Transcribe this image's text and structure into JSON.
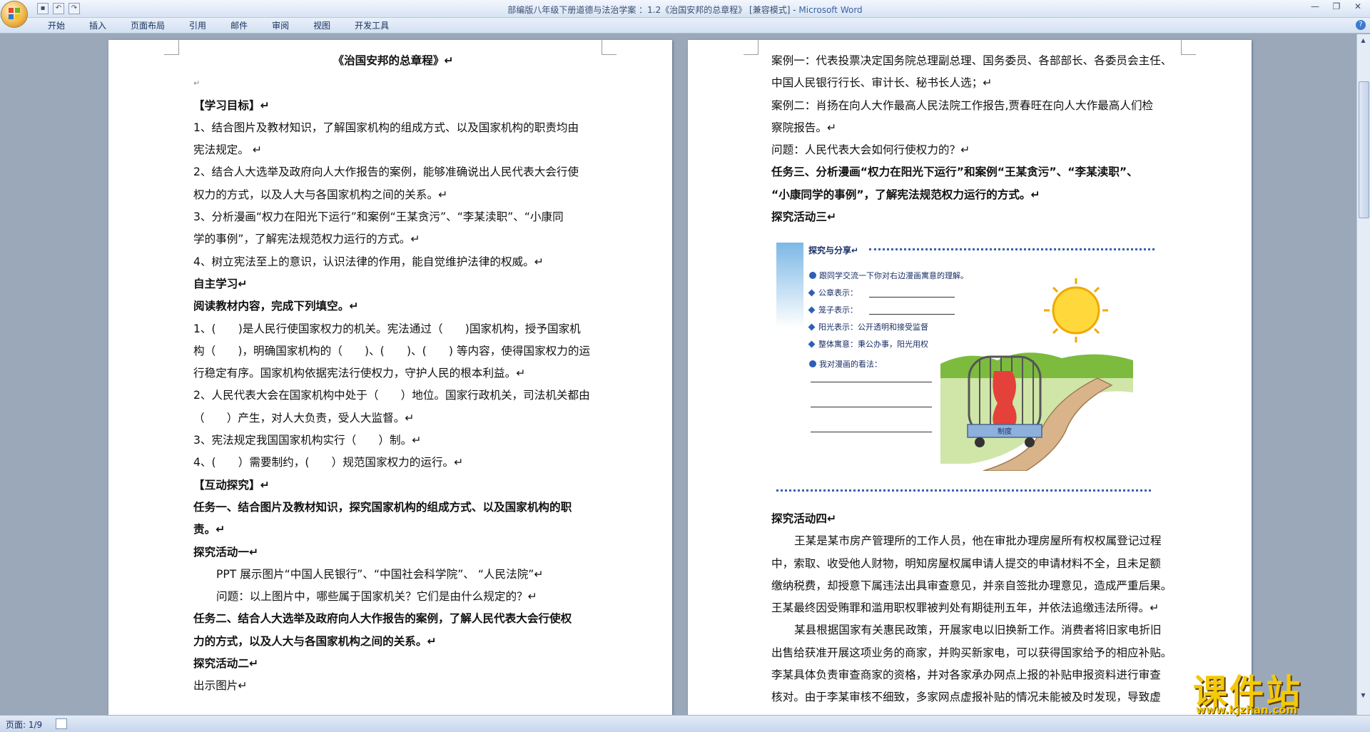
{
  "window": {
    "title": "部编版八年级下册道德与法治学案 ：1.2《治国安邦的总章程》 [兼容模式]",
    "app_name": "Microsoft Word"
  },
  "ribbon_tabs": [
    "开始",
    "插入",
    "页面布局",
    "引用",
    "邮件",
    "审阅",
    "视图",
    "开发工具"
  ],
  "status": {
    "page_info": "页面: 1/9"
  },
  "left_page": [
    {
      "t": "《治国安邦的总章程》↵",
      "s": "b ctr"
    },
    {
      "t": "↵",
      "s": "pm"
    },
    {
      "t": "【学习目标】↵",
      "s": "b"
    },
    {
      "t": "1、结合图片及教材知识，了解国家机构的组成方式、以及国家机构的职责均由",
      "s": ""
    },
    {
      "t": "宪法规定。 ↵",
      "s": ""
    },
    {
      "t": "2、结合人大选举及政府向人大作报告的案例，能够准确说出人民代表大会行使",
      "s": ""
    },
    {
      "t": "权力的方式，以及人大与各国家机构之间的关系。↵",
      "s": ""
    },
    {
      "t": "3、分析漫画“权力在阳光下运行”和案例“王某贪污”、“李某渎职”、“小康同",
      "s": ""
    },
    {
      "t": "学的事例”，了解宪法规范权力运行的方式。↵",
      "s": ""
    },
    {
      "t": "4、树立宪法至上的意识，认识法律的作用，能自觉维护法律的权威。↵",
      "s": ""
    },
    {
      "t": "自主学习↵",
      "s": "b"
    },
    {
      "t": "阅读教材内容，完成下列填空。↵",
      "s": "b"
    },
    {
      "t": "1、(　　)是人民行使国家权力的机关。宪法通过（　　)国家机构，授予国家机",
      "s": ""
    },
    {
      "t": "构（　　)，明确国家机构的（　　)、(　　)、(　　) 等内容，使得国家权力的运",
      "s": ""
    },
    {
      "t": "行稳定有序。国家机构依据宪法行使权力，守护人民的根本利益。↵",
      "s": ""
    },
    {
      "t": "2、人民代表大会在国家机构中处于（　　）地位。国家行政机关，司法机关都由",
      "s": ""
    },
    {
      "t": "（　　）产生，对人大负责，受人大监督。↵",
      "s": ""
    },
    {
      "t": "3、宪法规定我国国家机构实行（　　）制。↵",
      "s": ""
    },
    {
      "t": "4、(　　）需要制约，(　　）规范国家权力的运行。↵",
      "s": ""
    },
    {
      "t": "【互动探究】↵",
      "s": "b"
    },
    {
      "t": "任务一、结合图片及教材知识，探究国家机构的组成方式、以及国家机构的职",
      "s": "b"
    },
    {
      "t": "责。↵",
      "s": "b"
    },
    {
      "t": "探究活动一↵",
      "s": "b"
    },
    {
      "t": "PPT 展示图片“中国人民银行”、“中国社会科学院”、 “人民法院”↵",
      "s": "ind"
    },
    {
      "t": "问题：以上图片中，哪些属于国家机关？它们是由什么规定的？↵",
      "s": "ind"
    },
    {
      "t": "任务二、结合人大选举及政府向人大作报告的案例，了解人民代表大会行使权",
      "s": "b"
    },
    {
      "t": "力的方式，以及人大与各国家机构之间的关系。↵",
      "s": "b"
    },
    {
      "t": "探究活动二↵",
      "s": "b"
    },
    {
      "t": "出示图片↵",
      "s": ""
    }
  ],
  "right_page_top": [
    {
      "t": "案例一：代表投票决定国务院总理副总理、国务委员、各部部长、各委员会主任、",
      "s": ""
    },
    {
      "t": "中国人民银行行长、审计长、秘书长人选；↵",
      "s": ""
    },
    {
      "t": "案例二：肖扬在向人大作最高人民法院工作报告,贾春旺在向人大作最高人们检",
      "s": ""
    },
    {
      "t": "察院报告。↵",
      "s": ""
    },
    {
      "t": "问题：人民代表大会如何行使权力的？↵",
      "s": ""
    },
    {
      "t": "任务三、分析漫画“权力在阳光下运行”和案例“王某贪污”、“李某渎职”、",
      "s": "b"
    },
    {
      "t": "“小康同学的事例”，了解宪法规范权力运行的方式。↵",
      "s": "b"
    },
    {
      "t": "探究活动三↵",
      "s": "b"
    }
  ],
  "figure": {
    "heading": "探究与分享↵",
    "prompt": "跟同学交流一下你对右边漫画寓意的理解。",
    "items": [
      "公章表示：",
      "笼子表示：",
      "阳光表示：公开透明和接受监督",
      "整体寓意：秉公办事，阳光用权"
    ],
    "my_view": "我对漫画的看法：",
    "cart_label": "制度"
  },
  "right_page_bottom": [
    {
      "t": "探究活动四↵",
      "s": "b"
    },
    {
      "t": "王某是某市房产管理所的工作人员，他在审批办理房屋所有权权属登记过程",
      "s": "ind"
    },
    {
      "t": "中，索取、收受他人财物，明知房屋权属申请人提交的申请材料不全，且未足额",
      "s": ""
    },
    {
      "t": "缴纳税费，却授意下属违法出具审查意见，并亲自签批办理意见，造成严重后果。",
      "s": ""
    },
    {
      "t": "王某最终因受贿罪和滥用职权罪被判处有期徒刑五年，并依法追缴违法所得。↵",
      "s": ""
    },
    {
      "t": "某县根据国家有关惠民政策，开展家电以旧换新工作。消费者将旧家电折旧",
      "s": "ind"
    },
    {
      "t": "出售给获准开展这项业务的商家，并购买新家电，可以获得国家给予的相应补贴。",
      "s": ""
    },
    {
      "t": "李某具体负责审查商家的资格，并对各家承办网点上报的补贴申报资料进行审查",
      "s": ""
    },
    {
      "t": "核对。由于李某审核不细致，多家网点虚报补贴的情况未能被及时发现，导致虚",
      "s": ""
    }
  ],
  "watermark": {
    "text": "课件站",
    "url": "www.kjzhan.com"
  }
}
